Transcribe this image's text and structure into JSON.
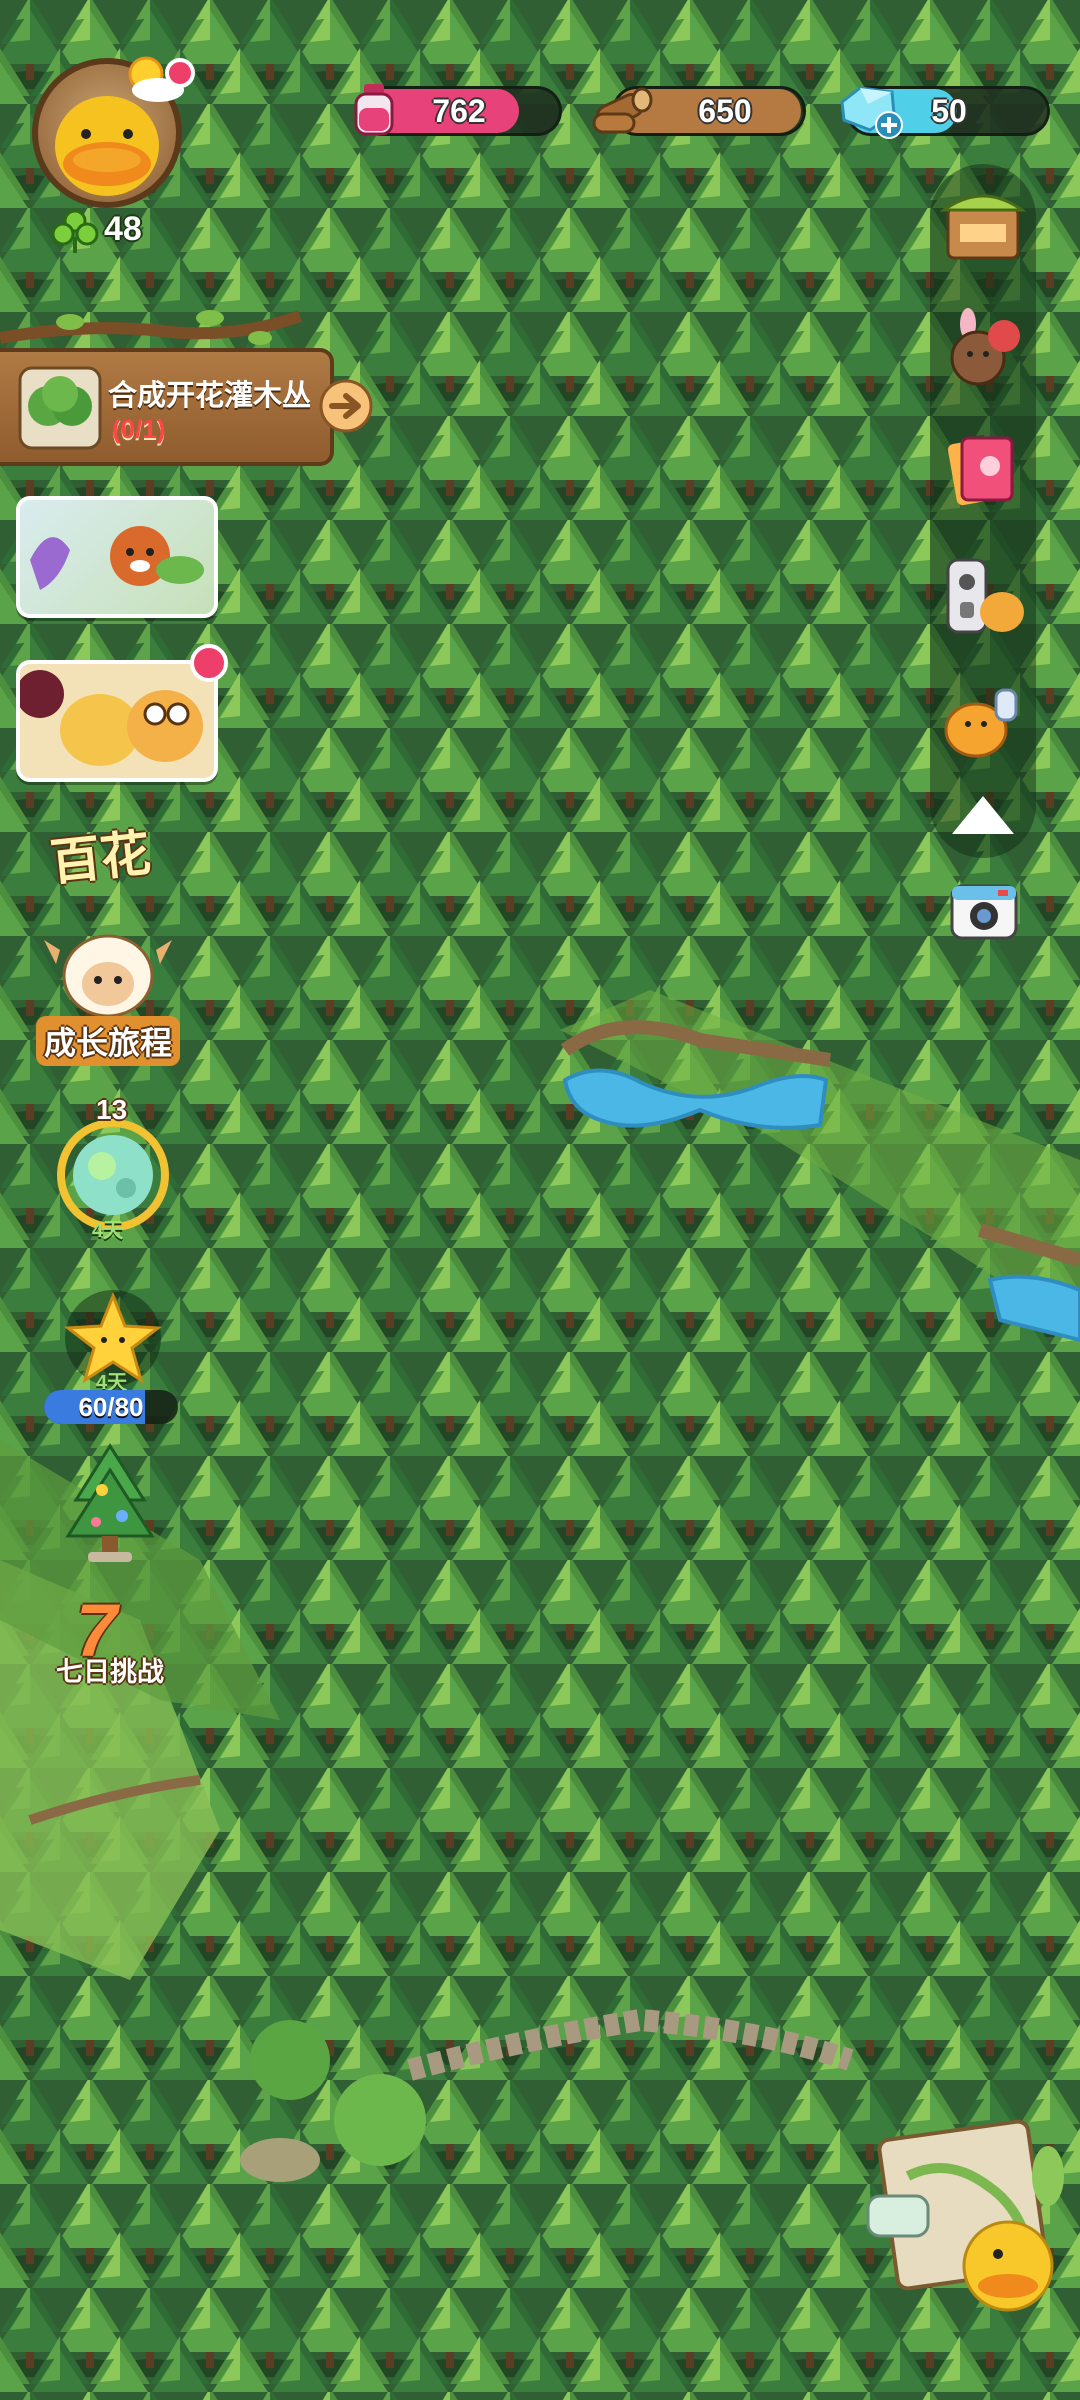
{
  "resources": {
    "ink": {
      "value": "762",
      "icon": "ink-bottle-icon",
      "color": "#e8427a"
    },
    "wood": {
      "value": "650",
      "icon": "wood-log-icon",
      "color": "#b47a42"
    },
    "gems": {
      "value": "50",
      "icon": "blue-gem-icon",
      "add_icon": "plus-icon",
      "color": "#4fd0e8"
    }
  },
  "player": {
    "avatar_icon": "yellow-duck-icon",
    "weather_icon": "sun-cloud-icon",
    "clover_icon": "clover-icon",
    "clover_count": "48"
  },
  "quest": {
    "icon": "flowering-bush-icon",
    "title": "合成开花灌木丛",
    "progress": "(0/1)",
    "arrow_icon": "arrow-right-icon"
  },
  "left_events": {
    "event_card_1_icon": "red-panda-forest-event-icon",
    "event_card_2_icon": "duck-friends-event-icon",
    "baihua_label": "百花",
    "growth_journey_label": "成长旅程",
    "planet_level": "13",
    "planet_days": "4天",
    "star_days": "4天",
    "star_progress": "60/80",
    "star_progress_fraction": 0.75,
    "tree_event_icon": "decorated-tree-icon",
    "seven_day_number": "7",
    "seven_day_label": "七日挑战"
  },
  "right_tools": [
    {
      "name": "shop-stall-icon"
    },
    {
      "name": "animal-friends-icon"
    },
    {
      "name": "collection-book-icon"
    },
    {
      "name": "remote-control-icon"
    },
    {
      "name": "duck-thumbs-up-icon"
    },
    {
      "name": "collapse-arrow-icon"
    },
    {
      "name": "camera-icon"
    }
  ],
  "colors": {
    "forest_dark": "#2f5f32",
    "forest_mid": "#4c8a3e",
    "forest_light": "#7cb84f",
    "water": "#4ab7e6",
    "path": "#8a7a5a",
    "panel_wood": "#a06a36"
  },
  "map_icon": "treasure-map-duck-icon"
}
